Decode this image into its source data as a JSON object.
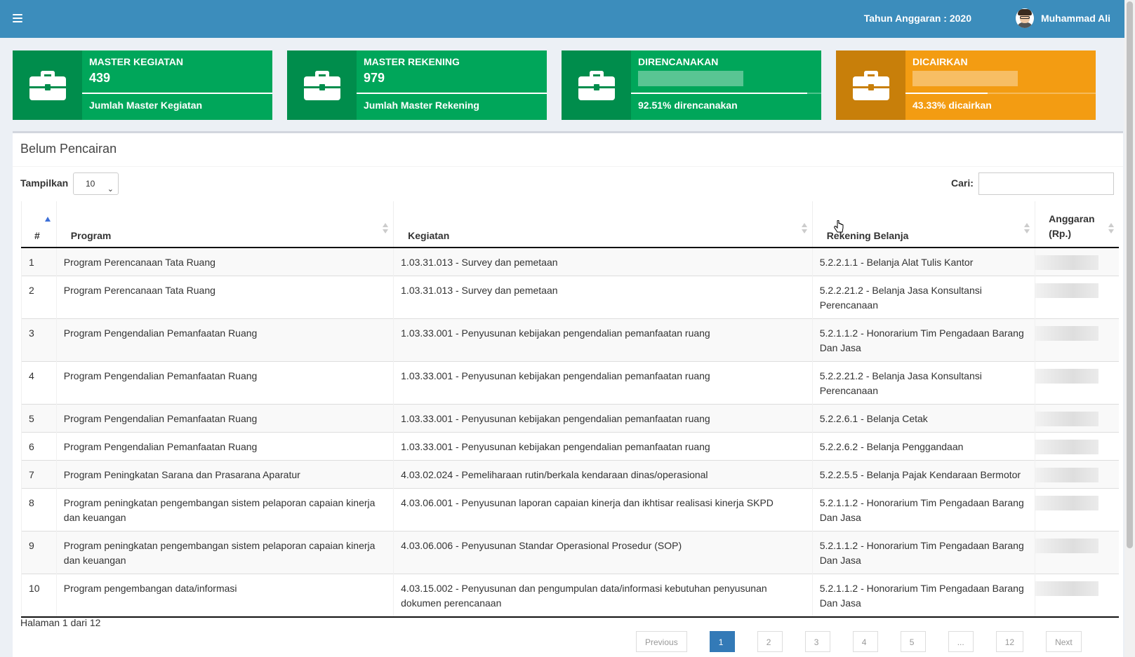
{
  "header": {
    "year_label": "Tahun Anggaran : 2020",
    "user_name": "Muhammad Ali"
  },
  "info_boxes": [
    {
      "title": "MASTER KEGIATAN",
      "value": "439",
      "desc": "Jumlah Master Kegiatan",
      "progress": 100,
      "color": "#00a65a"
    },
    {
      "title": "MASTER REKENING",
      "value": "979",
      "desc": "Jumlah Master Rekening",
      "progress": 100,
      "color": "#00a65a"
    },
    {
      "title": "DIRENCANAKAN",
      "value": "",
      "desc": "92.51% direncanakan",
      "progress": 92.51,
      "color": "#00a65a"
    },
    {
      "title": "DICAIRKAN",
      "value": "",
      "desc": "43.33% dicairkan",
      "progress": 43.33,
      "color": "#f39c12"
    }
  ],
  "panel": {
    "title": "Belum Pencairan",
    "length_label": "Tampilkan",
    "length_value": "10",
    "search_label": "Cari:",
    "search_value": ""
  },
  "table": {
    "columns": [
      "#",
      "Program",
      "Kegiatan",
      "Rekening Belanja",
      "Anggaran (Rp.)"
    ],
    "rows": [
      [
        "1",
        "Program Perencanaan Tata Ruang",
        "1.03.31.013 - Survey dan pemetaan",
        "5.2.2.1.1 - Belanja Alat Tulis Kantor"
      ],
      [
        "2",
        "Program Perencanaan Tata Ruang",
        "1.03.31.013 - Survey dan pemetaan",
        "5.2.2.21.2 - Belanja Jasa Konsultansi Perencanaan"
      ],
      [
        "3",
        "Program Pengendalian Pemanfaatan Ruang",
        "1.03.33.001 - Penyusunan kebijakan pengendalian pemanfaatan ruang",
        "5.2.1.1.2 - Honorarium Tim Pengadaan Barang Dan Jasa"
      ],
      [
        "4",
        "Program Pengendalian Pemanfaatan Ruang",
        "1.03.33.001 - Penyusunan kebijakan pengendalian pemanfaatan ruang",
        "5.2.2.21.2 - Belanja Jasa Konsultansi Perencanaan"
      ],
      [
        "5",
        "Program Pengendalian Pemanfaatan Ruang",
        "1.03.33.001 - Penyusunan kebijakan pengendalian pemanfaatan ruang",
        "5.2.2.6.1 - Belanja Cetak"
      ],
      [
        "6",
        "Program Pengendalian Pemanfaatan Ruang",
        "1.03.33.001 - Penyusunan kebijakan pengendalian pemanfaatan ruang",
        "5.2.2.6.2 - Belanja Penggandaan"
      ],
      [
        "7",
        "Program Peningkatan Sarana dan Prasarana Aparatur",
        "4.03.02.024 - Pemeliharaan rutin/berkala kendaraan dinas/operasional",
        "5.2.2.5.5 - Belanja Pajak Kendaraan Bermotor"
      ],
      [
        "8",
        "Program peningkatan pengembangan sistem pelaporan capaian kinerja dan keuangan",
        "4.03.06.001 - Penyusunan laporan capaian kinerja dan ikhtisar realisasi kinerja SKPD",
        "5.2.1.1.2 - Honorarium Tim Pengadaan Barang Dan Jasa"
      ],
      [
        "9",
        "Program peningkatan pengembangan sistem pelaporan capaian kinerja dan keuangan",
        "4.03.06.006 - Penyusunan Standar Operasional Prosedur (SOP)",
        "5.2.1.1.2 - Honorarium Tim Pengadaan Barang Dan Jasa"
      ],
      [
        "10",
        "Program pengembangan data/informasi",
        "4.03.15.002 - Penyusunan dan pengumpulan data/informasi kebutuhan penyusunan dokumen perencanaan",
        "5.2.1.1.2 - Honorarium Tim Pengadaan Barang Dan Jasa"
      ]
    ]
  },
  "footer": {
    "page_info": "Halaman 1 dari 12",
    "pages": [
      "Previous",
      "1",
      "2",
      "3",
      "4",
      "5",
      "...",
      "12",
      "Next"
    ]
  }
}
